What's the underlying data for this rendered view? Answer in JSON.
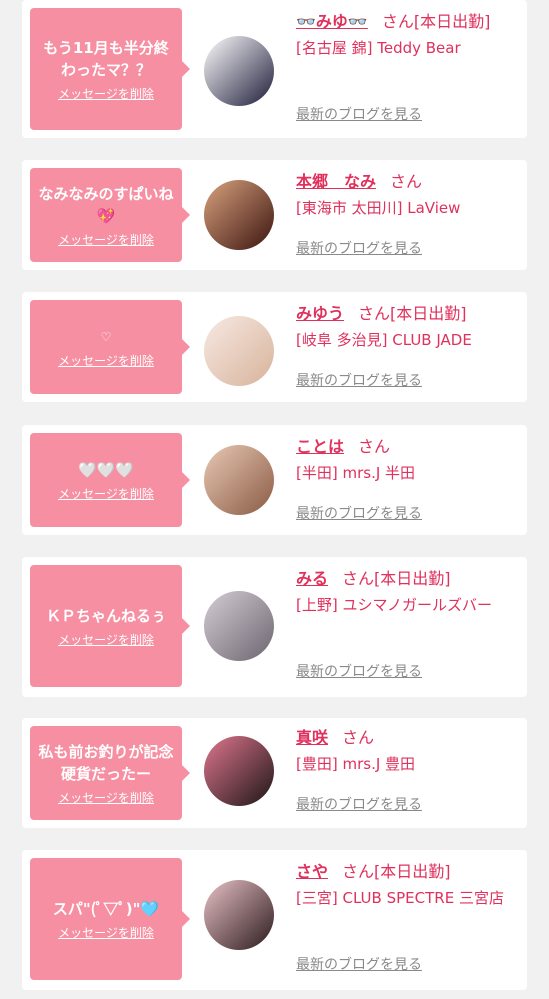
{
  "messages": [
    {
      "message": "もう11月も半分終わったマ？？",
      "delete_label": "メッセージを削除",
      "name": "👓みゆ👓",
      "san": "さん",
      "status": "[本日出勤]",
      "shop": "[名古屋 錦] Teddy Bear",
      "blog_label": "最新のブログを見る",
      "avatar_colors": [
        "#ffffff",
        "#1e1c3a"
      ]
    },
    {
      "message": "なみなみのすぱいね💖",
      "delete_label": "メッセージを削除",
      "name": "本郷　なみ",
      "san": "さん",
      "status": "",
      "shop": "[東海市 太田川] LaView",
      "blog_label": "最新のブログを見る",
      "avatar_colors": [
        "#d9a27d",
        "#3b1410"
      ]
    },
    {
      "message": "♡",
      "delete_label": "メッセージを削除",
      "name": "みゆう",
      "san": "さん",
      "status": "[本日出勤]",
      "shop": "[岐阜 多治見] CLUB JADE",
      "blog_label": "最新のブログを見る",
      "avatar_colors": [
        "#f7e9e4",
        "#d7b39a"
      ]
    },
    {
      "message": "🤍🤍🤍",
      "delete_label": "メッセージを削除",
      "name": "ことは",
      "san": "さん",
      "status": "",
      "shop": "[半田] mrs.J 半田",
      "blog_label": "最新のブログを見る",
      "avatar_colors": [
        "#e8c9b4",
        "#8a5a44"
      ]
    },
    {
      "message": "ＫＰちゃんねるぅ",
      "delete_label": "メッセージを削除",
      "name": "みる",
      "san": "さん",
      "status": "[本日出勤]",
      "shop": "[上野] ユシマノガールズバー",
      "blog_label": "最新のブログを見る",
      "avatar_colors": [
        "#d4cdd4",
        "#6c6570"
      ]
    },
    {
      "message": "私も前お釣りが記念硬貨だったー",
      "delete_label": "メッセージを削除",
      "name": "真咲",
      "san": "さん",
      "status": "",
      "shop": "[豊田] mrs.J 豊田",
      "blog_label": "最新のブログを見る",
      "avatar_colors": [
        "#e0768f",
        "#1c1616"
      ]
    },
    {
      "message": "スパ\"(ﾟ▽ﾟ)\"🩵",
      "delete_label": "メッセージを削除",
      "name": "さや",
      "san": "さん",
      "status": "[本日出勤]",
      "shop": "[三宮] CLUB SPECTRE 三宮店",
      "blog_label": "最新のブログを見る",
      "avatar_colors": [
        "#e9c2c7",
        "#2a1a1c"
      ]
    }
  ]
}
